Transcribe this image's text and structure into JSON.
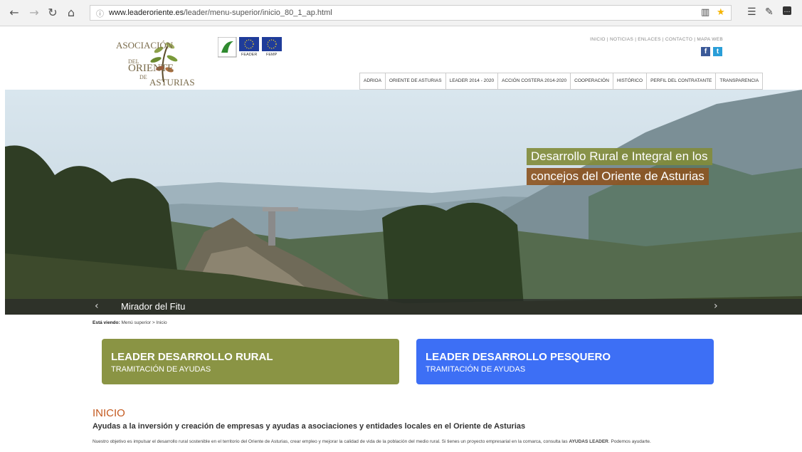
{
  "browser": {
    "back": "←",
    "forward": "→",
    "refresh": "↻",
    "home": "⌂",
    "url_domain": "www.leaderoriente.es",
    "url_path": "/leader/menu-superior/inicio_80_1_ap.html",
    "star": "★"
  },
  "logo": {
    "line1": "ASOCIACIÓN",
    "line2": "DEL",
    "line3": "ORIENTE",
    "line4": "DE",
    "line5": "ASTURIAS"
  },
  "eu": {
    "feader": "FEADER",
    "femp": "FEMP"
  },
  "top_links": "INICIO | NOTICIAS | ENLACES | CONTACTO | MAPA WEB",
  "social": {
    "facebook": "f",
    "twitter": "t"
  },
  "menu": [
    "ADRIOA",
    "ORIENTE DE ASTURIAS",
    "LEADER 2014 - 2020",
    "ACCIÓN COSTERA 2014-2020",
    "COOPERACIÓN",
    "HISTÓRICO",
    "PERFIL DEL CONTRATANTE",
    "TRANSPARENCIA"
  ],
  "hero": {
    "caption_line1": "Desarrollo Rural e Integral en los",
    "caption_line2": "concejos del Oriente de Asturias",
    "slide_title": "Mirador del Fitu",
    "prev": "‹",
    "next": "›"
  },
  "breadcrumb": {
    "label": "Está viendo:",
    "path": "Menú superior > Inicio"
  },
  "cards": [
    {
      "title": "LEADER DESARROLLO RURAL",
      "subtitle": "TRAMITACIÓN DE AYUDAS",
      "color": "#8a9444"
    },
    {
      "title": "LEADER DESARROLLO PESQUERO",
      "subtitle": "TRAMITACIÓN DE AYUDAS",
      "color": "#3d6ff5"
    }
  ],
  "content": {
    "heading": "INICIO",
    "subtitle": "Ayudas a la inversión y creación de empresas y ayudas a asociaciones y entidades locales en el Oriente de Asturias",
    "body_pre": "Nuestro objetivo es impulsar el desarrollo rural sostenible en el territorio del Oriente de Asturias, crear empleo y mejorar la calidad de vida de la población del medio rural. Si tienes un proyecto empresarial en la comarca, consulta las ",
    "body_bold": "AYUDAS LEADER",
    "body_post": ". Podemos ayudarte."
  }
}
